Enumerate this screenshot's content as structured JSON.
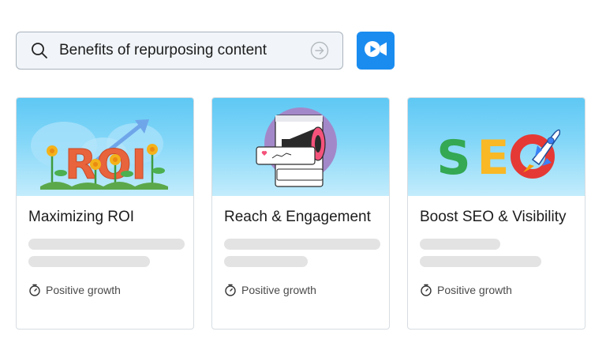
{
  "search": {
    "query": "Benefits of repurposing content",
    "icon": "search-icon",
    "submit_icon": "arrow-right-circle-icon"
  },
  "video_button": {
    "icon": "video-camera-icon",
    "color": "#1a8cf0"
  },
  "cards": [
    {
      "title": "Maximizing ROI",
      "image_text": "ROI",
      "meta": "Positive growth",
      "meta_icon": "stopwatch-icon"
    },
    {
      "title": "Reach & Engagement",
      "image_text": "",
      "meta": "Positive growth",
      "meta_icon": "stopwatch-icon"
    },
    {
      "title": "Boost SEO & Visibility",
      "image_text": "SEO",
      "meta": "Positive growth",
      "meta_icon": "stopwatch-icon"
    }
  ],
  "colors": {
    "sky_top": "#5ec8f4",
    "roi_letters": "#e8643c",
    "seo_s": "#34a853",
    "seo_e": "#f9b825",
    "seo_o": "#e53935",
    "skeleton": "#e3e3e3"
  }
}
